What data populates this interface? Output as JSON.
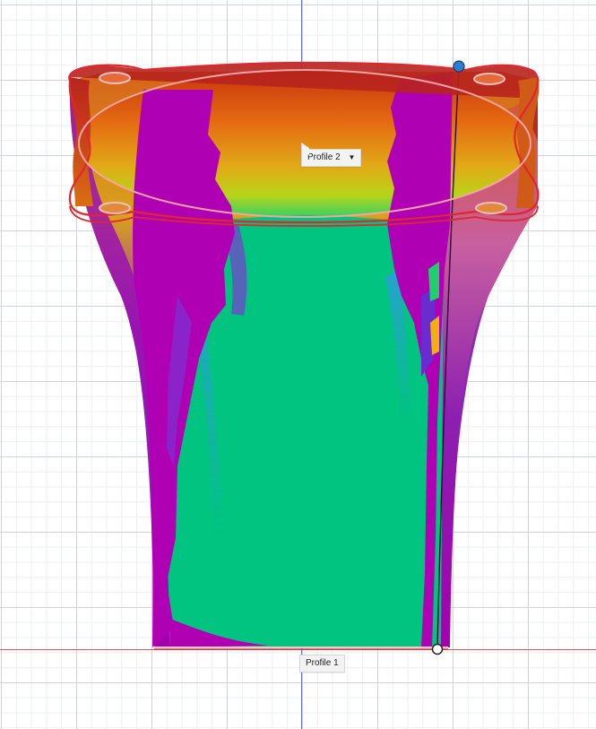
{
  "viewport": {
    "profile_tags": [
      {
        "label": "Profile 2",
        "has_dropdown": true
      },
      {
        "label": "Profile 1",
        "has_dropdown": false
      }
    ],
    "dropdown_icon": "caret-down-icon",
    "colors": {
      "axis_vertical": "#6b6bd6",
      "axis_horizontal": "#e05555",
      "profile_outline": "#e0262e",
      "analysis_green": "#00c47f",
      "analysis_magenta": "#b000b4",
      "analysis_orange": "#e15a12"
    }
  }
}
